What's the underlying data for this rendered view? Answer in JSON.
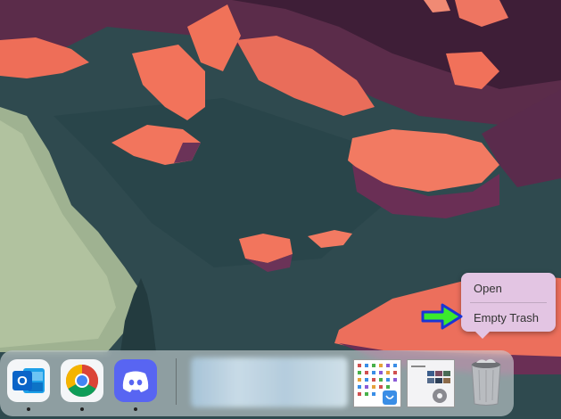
{
  "context_menu": {
    "open_label": "Open",
    "empty_trash_label": "Empty Trash"
  },
  "dock": {
    "apps": [
      "outlook-icon",
      "chrome-icon",
      "discord-icon"
    ],
    "outlook_letter": "O"
  },
  "colors": {
    "menu_bg": "#e3c5e3",
    "arrow_fill": "#3bea2c",
    "arrow_stroke": "#1a35d6",
    "outlook_blue": "#0a64c8",
    "discord_blurple": "#5865f2"
  }
}
